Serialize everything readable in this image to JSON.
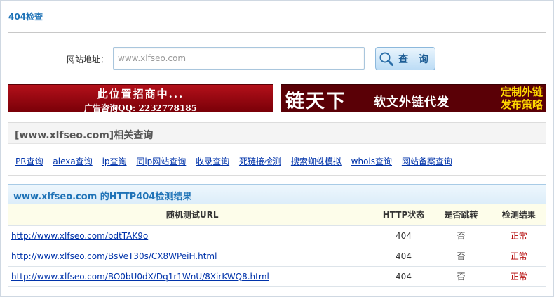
{
  "page": {
    "title": "404检查"
  },
  "form": {
    "label": "网站地址：",
    "input_value": "www.xlfseo.com",
    "button_label": "查 询"
  },
  "banners": {
    "left_line1": "此位置招商中...",
    "left_line2": "广告咨询QQ: 2232778185",
    "right_big": "链天下",
    "right_mid": "软文外链代发",
    "right_side1": "定制外链",
    "right_side2": "发布策略"
  },
  "related": {
    "title": "[www.xlfseo.com]相关查询",
    "links": [
      "PR查询",
      "alexa查询",
      "ip查询",
      "同ip网站查询",
      "收录查询",
      "死链接检测",
      "搜索蜘蛛模拟",
      "whois查询",
      "网站备案查询"
    ]
  },
  "results": {
    "title": "www.xlfseo.com 的HTTP404检测结果",
    "columns": [
      "随机测试URL",
      "HTTP状态",
      "是否跳转",
      "检测结果"
    ],
    "rows": [
      [
        "http://www.xlfseo.com/bdtTAK9o",
        "404",
        "否",
        "正常"
      ],
      [
        "http://www.xlfseo.com/BsVeT30s/CX8WPeiH.html",
        "404",
        "否",
        "正常"
      ],
      [
        "http://www.xlfseo.com/BO0bU0dX/Dq1r1WnU/8XirKWQ8.html",
        "404",
        "否",
        "正常"
      ]
    ]
  },
  "colors": {
    "accent": "#1f73b7",
    "link": "#0033aa",
    "ok": "#b20000",
    "banner": "#7a0008"
  }
}
